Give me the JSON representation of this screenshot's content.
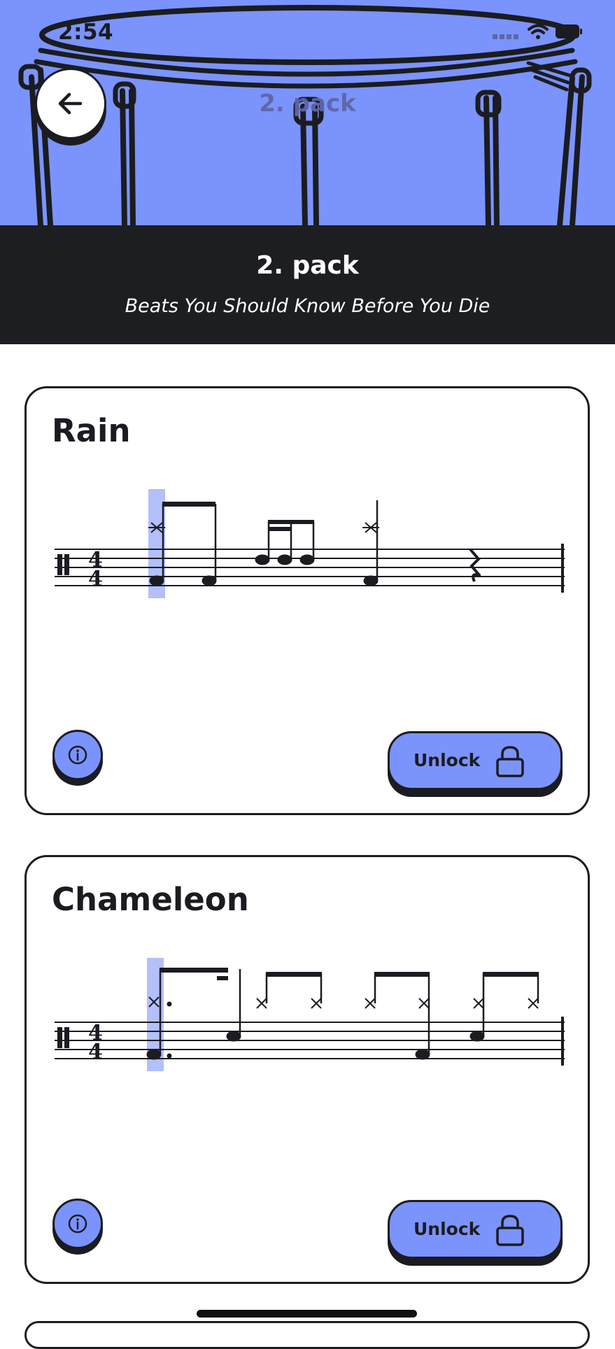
{
  "status_bar": {
    "time": "2:54"
  },
  "header": {
    "hero_title": "2. pack",
    "title": "2. pack",
    "subtitle": "Beats You Should Know Before You Die"
  },
  "colors": {
    "accent": "#7b93fc",
    "dark": "#1d1e22",
    "highlight": "#b3c0fa"
  },
  "icons": {
    "back": "arrow-left-icon",
    "info": "info-icon",
    "lock": "lock-icon",
    "signal": "signal-icon",
    "wifi": "wifi-icon",
    "battery": "battery-icon"
  },
  "beats": [
    {
      "name": "Rain",
      "action_label": "Unlock",
      "time_signature": "4/4"
    },
    {
      "name": "Chameleon",
      "action_label": "Unlock",
      "time_signature": "4/4"
    }
  ]
}
